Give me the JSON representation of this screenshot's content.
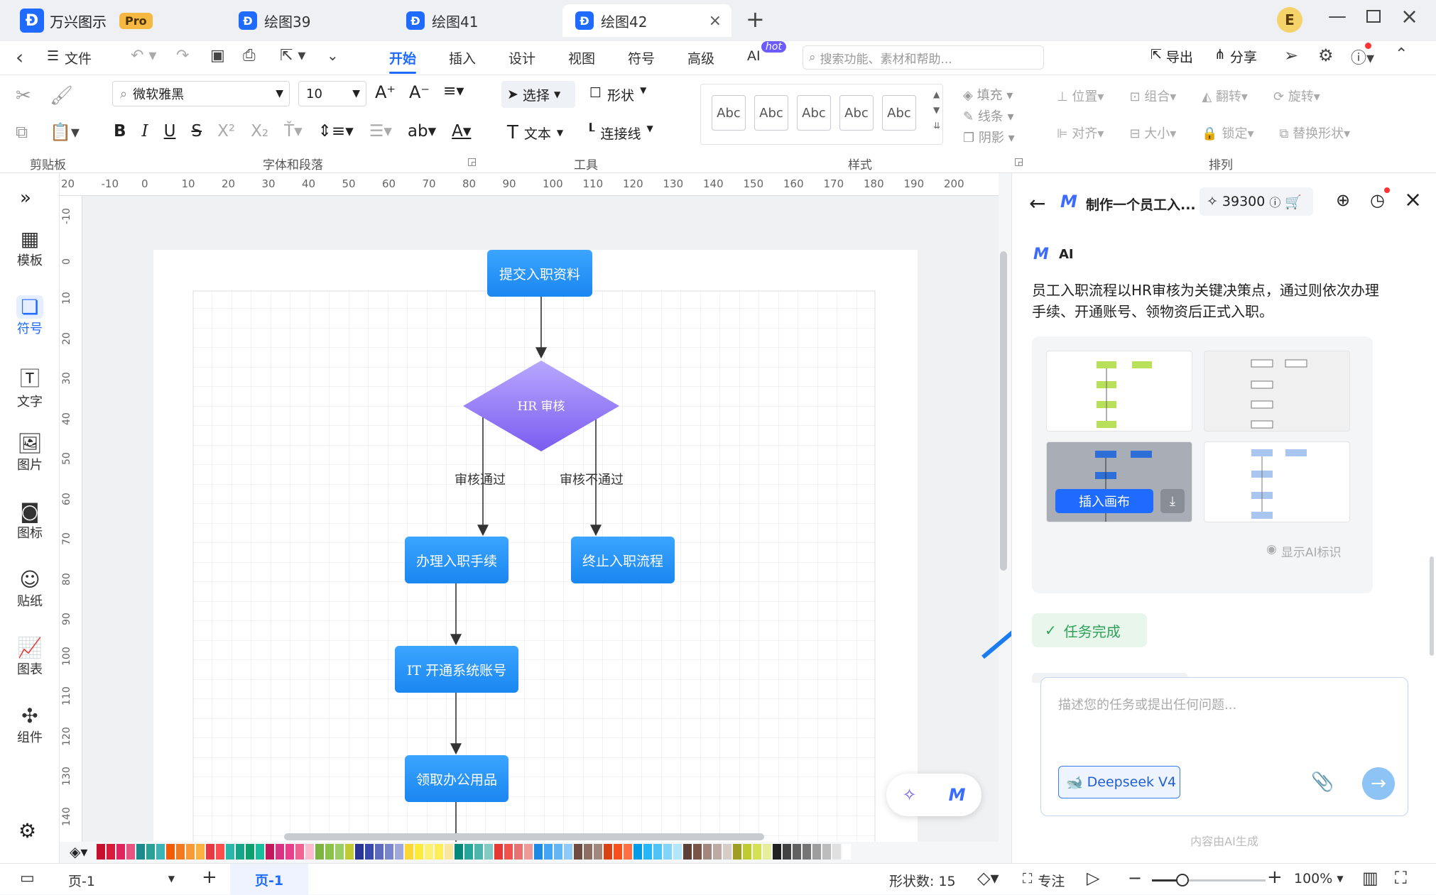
{
  "titlebar": {
    "app_name": "万兴图示",
    "badge": "Pro",
    "tabs": [
      {
        "label": "绘图39"
      },
      {
        "label": "绘图41"
      },
      {
        "label": "绘图42"
      }
    ],
    "avatar_letter": "E"
  },
  "menu": {
    "items": [
      "文件",
      "开始",
      "插入",
      "设计",
      "视图",
      "符号",
      "高级",
      "AI"
    ],
    "ai_badge": "hot",
    "search_placeholder": "搜索功能、素材和帮助...",
    "export": "导出",
    "share": "分享"
  },
  "ribbon": {
    "font_name": "微软雅黑",
    "font_size": "10",
    "select": "选择",
    "shape": "形状",
    "text": "文本",
    "connector": "连接线",
    "style_samples": [
      "Abc",
      "Abc",
      "Abc",
      "Abc",
      "Abc"
    ],
    "fill": "填充",
    "line": "线条",
    "shadow": "阴影",
    "position": "位置",
    "group": "组合",
    "flip": "翻转",
    "rotate": "旋转",
    "align": "对齐",
    "size": "大小",
    "lock": "锁定",
    "replace": "替换形状",
    "groups": [
      "剪贴板",
      "字体和段落",
      "工具",
      "样式",
      "排列"
    ]
  },
  "sidebar": {
    "items": [
      "模板",
      "符号",
      "文字",
      "图片",
      "图标",
      "贴纸",
      "图表",
      "组件"
    ]
  },
  "ruler": {
    "top": [
      "20",
      "-10",
      "0",
      "10",
      "20",
      "30",
      "40",
      "50",
      "60",
      "70",
      "80",
      "90",
      "100",
      "110",
      "120",
      "130",
      "140",
      "150",
      "160",
      "170",
      "180",
      "190",
      "200"
    ],
    "left": [
      "-10",
      "0",
      "10",
      "20",
      "30",
      "40",
      "50",
      "60",
      "70",
      "80",
      "90",
      "100",
      "110",
      "120",
      "130",
      "140"
    ]
  },
  "flowchart": {
    "nodes": {
      "start": "提交入职资料",
      "decision": "HR 审核",
      "n1": "办理入职手续",
      "n2": "终止入职流程",
      "n3": "IT 开通系统账号",
      "n4": "领取办公用品"
    },
    "edges": {
      "pass": "审核通过",
      "fail": "审核不通过"
    }
  },
  "ai_panel": {
    "title": "制作一个员工入...",
    "credits": "39300",
    "ai_label": "AI",
    "message": "员工入职流程以HR审核为关键决策点，通过则依次办理手续、开通账号、领物资后正式入职。",
    "insert_button": "插入画布",
    "show_ai_mark": "显示AI标识",
    "task_done": "任务完成",
    "input_placeholder": "描述您的任务或提出任何问题...",
    "model": "Deepseek V4",
    "footer": "内容由AI生成"
  },
  "palette": [
    "#c8102e",
    "#d81b3c",
    "#e0245e",
    "#e75480",
    "#1b8a8a",
    "#2aa198",
    "#3cb4b4",
    "#f25c05",
    "#f47a20",
    "#f89a35",
    "#fbb040",
    "#e63946",
    "#ff4d4d",
    "#2ab7a9",
    "#17a589",
    "#0e9f6e",
    "#1abc9c",
    "#c2185b",
    "#d63384",
    "#e83e8c",
    "#f06292",
    "#f8bbd0",
    "#7cb342",
    "#8bc34a",
    "#9ccc65",
    "#c0ca33",
    "#283593",
    "#3949ab",
    "#5c6bc0",
    "#7986cb",
    "#9fa8da",
    "#fdd835",
    "#ffeb3b",
    "#fff176",
    "#ffee58",
    "#f9e79f",
    "#00897b",
    "#26a69a",
    "#4db6ac",
    "#80cbc4",
    "#e53935",
    "#ef5350",
    "#e57373",
    "#ef9a9a",
    "#1e88e5",
    "#42a5f5",
    "#64b5f6",
    "#90caf9",
    "#6d4c41",
    "#8d6e63",
    "#a1887f",
    "#d84315",
    "#f4511e",
    "#ff7043",
    "#039be5",
    "#29b6f6",
    "#4fc3f7",
    "#81d4fa",
    "#b3e5fc",
    "#5d4037",
    "#795548",
    "#a1887f",
    "#bcaaa4",
    "#d7ccc8",
    "#9e9d24",
    "#c0ca33",
    "#d4e157",
    "#e6ee9c",
    "#212121",
    "#424242",
    "#616161",
    "#757575",
    "#9e9e9e",
    "#bdbdbd",
    "#e0e0e0",
    "#ffffff"
  ],
  "status": {
    "page_selector": "页-1",
    "page_tab": "页-1",
    "shape_count": "形状数: 15",
    "focus": "专注",
    "zoom": "100%"
  }
}
